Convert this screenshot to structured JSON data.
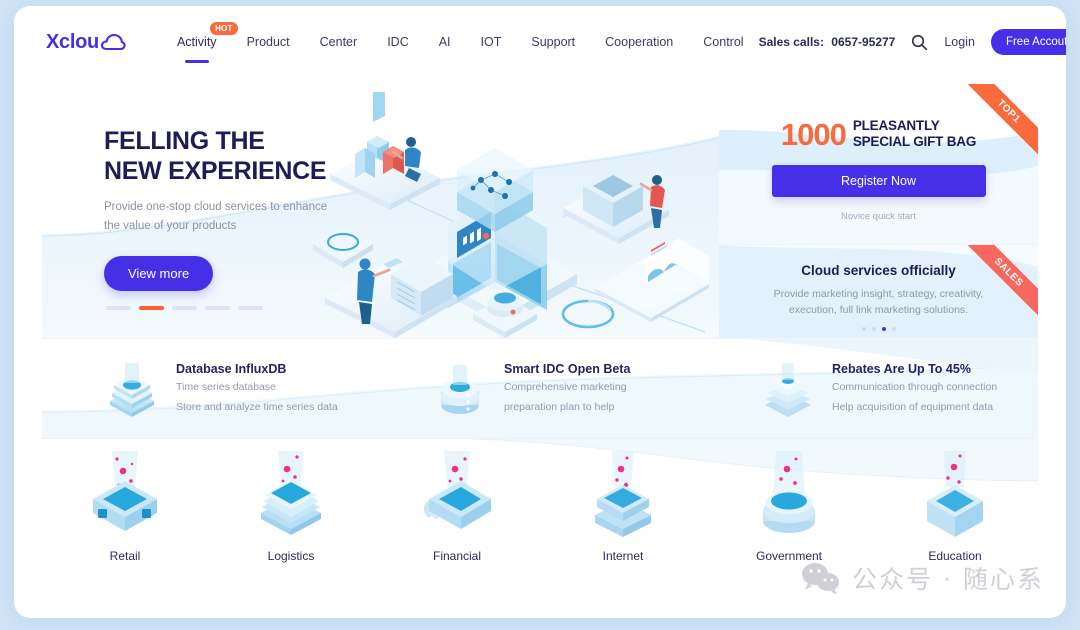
{
  "brand": {
    "logo_text": "Xclou",
    "logo_icon": "cloud-icon",
    "accent": "#4530e8",
    "orange": "#fa6a3c",
    "dark": "#1e1b58"
  },
  "header": {
    "nav": [
      {
        "label": "Activity",
        "active": true,
        "badge": "HOT"
      },
      {
        "label": "Product",
        "active": false
      },
      {
        "label": "Center",
        "active": false
      },
      {
        "label": "IDC",
        "active": false
      },
      {
        "label": "AI",
        "active": false
      },
      {
        "label": "IOT",
        "active": false
      },
      {
        "label": "Support",
        "active": false
      },
      {
        "label": "Cooperation",
        "active": false
      },
      {
        "label": "Control",
        "active": false
      }
    ],
    "sales_label": "Sales calls:",
    "sales_number": "0657-95277",
    "search_icon": "search-icon",
    "login_label": "Login",
    "free_account_label": "Free Accout"
  },
  "hero": {
    "title_line1": "FELLING THE",
    "title_line2": "NEW EXPERIENCE",
    "subtitle_line1": "Provide one-stop cloud services to enhance",
    "subtitle_line2": "the value of your products",
    "cta_label": "View more",
    "carousel": {
      "count": 5,
      "active_index": 1
    }
  },
  "promo_top": {
    "ribbon": "TOP1",
    "number": "1000",
    "headline_line1": "PLEASANTLY",
    "headline_line2": "SPECIAL GIFT BAG",
    "cta_label": "Register Now",
    "footnote": "Novice quick start"
  },
  "promo_bottom": {
    "ribbon": "SALES",
    "title": "Cloud services officially",
    "sub_line1": "Provide marketing insight, strategy, creativity,",
    "sub_line2": "execution, full link marketing solutions.",
    "carousel": {
      "count": 4,
      "active_index": 2
    }
  },
  "features": [
    {
      "icon": "database-stack-icon",
      "title": "Database InfluxDB",
      "line1": "Time series database",
      "line2": "Store and analyze time series data"
    },
    {
      "icon": "database-cylinder-icon",
      "title": "Smart IDC Open Beta",
      "line1": "Comprehensive marketing",
      "line2": "preparation plan to help"
    },
    {
      "icon": "database-layers-icon",
      "title": "Rebates Are  Up To 45%",
      "line1": "Communication through connection",
      "line2": "Help acquisition of equipment data"
    }
  ],
  "industries": [
    {
      "label": "Retail",
      "icon": "retail-isometric-icon"
    },
    {
      "label": "Logistics",
      "icon": "logistics-isometric-icon"
    },
    {
      "label": "Financial",
      "icon": "financial-isometric-icon"
    },
    {
      "label": "Internet",
      "icon": "internet-isometric-icon"
    },
    {
      "label": "Government",
      "icon": "government-isometric-icon"
    },
    {
      "label": "Education",
      "icon": "education-isometric-icon"
    }
  ],
  "watermark": {
    "icon": "wechat-icon",
    "text": "公众号 · 随心系"
  }
}
